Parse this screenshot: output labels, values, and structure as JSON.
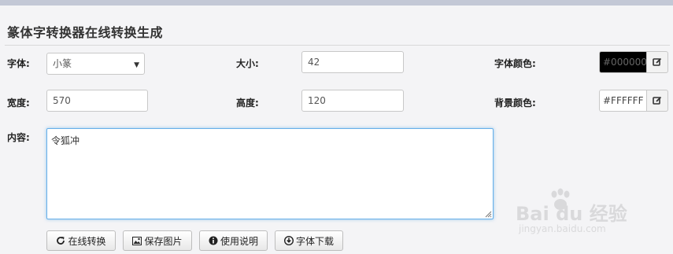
{
  "page": {
    "title": "篆体字转换器在线转换生成"
  },
  "form": {
    "font_label": "字体:",
    "font_value": "小篆",
    "size_label": "大小:",
    "size_value": "42",
    "color_label": "字体颜色:",
    "color_value": "#000000",
    "width_label": "宽度:",
    "width_value": "570",
    "height_label": "高度:",
    "height_value": "120",
    "bg_label": "背景颜色:",
    "bg_value": "#FFFFFF",
    "content_label": "内容:",
    "content_value": "令狐冲"
  },
  "buttons": {
    "convert": "在线转换",
    "save": "保存图片",
    "help": "使用说明",
    "download": "字体下载"
  },
  "watermark": {
    "logo": "Bai du 经验",
    "url": "jingyan.baidu.com"
  },
  "colors": {
    "font_color_swatch": "#000000",
    "bg_color_swatch": "#FFFFFF",
    "focus": "#66afe9"
  },
  "icons": [
    "caret-down-icon",
    "edit-icon",
    "refresh-icon",
    "image-icon",
    "info-circle-icon",
    "download-circle-icon"
  ]
}
